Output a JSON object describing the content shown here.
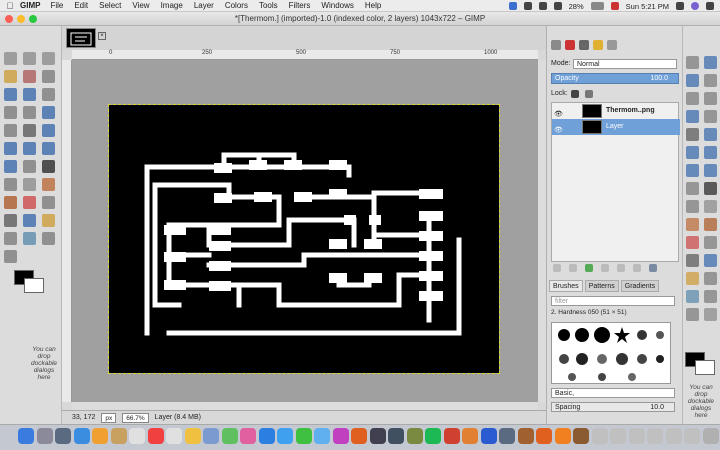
{
  "menubar": {
    "app_name": "GIMP",
    "menus": [
      "File",
      "Edit",
      "Select",
      "View",
      "Image",
      "Layer",
      "Colors",
      "Tools",
      "Filters",
      "Windows",
      "Help"
    ],
    "battery": "28%",
    "time": "Sun 5:21 PM"
  },
  "window": {
    "title": "*[Thermom.] (imported)-1.0 (indexed color, 2 layers) 1043x722 – GIMP"
  },
  "ruler": {
    "ticks": [
      "0",
      "250",
      "500",
      "750",
      "1000"
    ]
  },
  "toolbox": {
    "drop_text": "You can drop dockable dialogs here"
  },
  "status": {
    "coords": "33, 172",
    "unit": "px",
    "zoom": "66.7%",
    "info": "Layer (8.4 MB)"
  },
  "layers": {
    "mode_label": "Mode:",
    "mode_value": "Normal",
    "opacity_label": "Opacity",
    "opacity_value": "100.0",
    "lock_label": "Lock:",
    "items": [
      {
        "name": "Thermom..png"
      },
      {
        "name": "Layer"
      }
    ]
  },
  "brushes": {
    "tabs": [
      "Brushes",
      "Patterns",
      "Gradients"
    ],
    "filter_placeholder": "filter",
    "brush_name": "2. Hardness 050 (51 × 51)",
    "preset": "Basic,",
    "spacing_label": "Spacing",
    "spacing_value": "10.0"
  },
  "right_panel": {
    "drop_text": "You can drop dockable dialogs here"
  },
  "colors": {
    "accent": "#6fa0d8",
    "selected_layer": "#6fa0d8"
  }
}
